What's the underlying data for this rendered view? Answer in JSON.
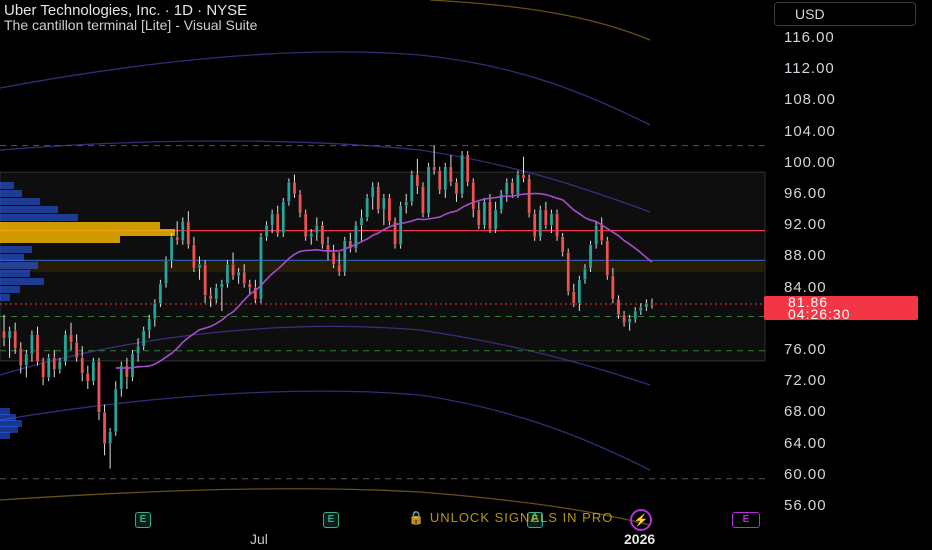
{
  "header": {
    "title": "Uber Technologies, Inc. · 1D · NYSE",
    "subtitle": "The cantillon terminal [Lite] - Visual Suite"
  },
  "currency": "USD",
  "last_price": {
    "value": "81.86",
    "countdown": "04:26:30"
  },
  "y_axis_labels": [
    "116.00",
    "112.00",
    "108.00",
    "104.00",
    "100.00",
    "96.00",
    "92.00",
    "88.00",
    "84.00",
    "76.00",
    "72.00",
    "68.00",
    "64.00",
    "60.00",
    "56.00"
  ],
  "x_axis_labels": [
    "Jul",
    "2026"
  ],
  "overlay": {
    "unlock_text": "UNLOCK SIGNALS IN PRO",
    "earnings_label": "E",
    "bolt_icon": "lightning-icon"
  },
  "colors": {
    "up": "#26a69a",
    "down": "#ef5350",
    "wick": "#e0e0e0",
    "ma": "#a64dc9",
    "band": "#4a3aa0",
    "band_outer": "#8a6a20",
    "red_line": "#f23645",
    "blue_line": "#3060c0",
    "volume_profile": "#2962ff",
    "poc": "#f0b400"
  },
  "chart_data": {
    "type": "candlestick",
    "symbol": "UBER",
    "interval": "1D",
    "exchange": "NYSE",
    "ylim": [
      54,
      118
    ],
    "last_price": 81.86,
    "horizontal_levels": {
      "resistance_dashed": 102.2,
      "range_top": 98.8,
      "red_line": 91.3,
      "blue_line": 87.5,
      "zone_bottom": 86.0,
      "price_dotted": 81.9,
      "green_dashed_1": 80.3,
      "green_dashed_2": 75.9,
      "range_bottom": 74.6,
      "lower_dashed": 59.5
    },
    "candles": [
      {
        "o": 78.5,
        "h": 80.5,
        "l": 76.5,
        "c": 77.5
      },
      {
        "o": 77.5,
        "h": 79.0,
        "l": 75.0,
        "c": 78.5
      },
      {
        "o": 78.5,
        "h": 79.5,
        "l": 75.5,
        "c": 76.2
      },
      {
        "o": 76.2,
        "h": 77.0,
        "l": 73.0,
        "c": 74.0
      },
      {
        "o": 74.0,
        "h": 76.0,
        "l": 72.5,
        "c": 75.5
      },
      {
        "o": 75.5,
        "h": 78.5,
        "l": 74.5,
        "c": 78.0
      },
      {
        "o": 78.0,
        "h": 79.0,
        "l": 74.0,
        "c": 74.5
      },
      {
        "o": 74.5,
        "h": 75.0,
        "l": 71.5,
        "c": 72.5
      },
      {
        "o": 72.5,
        "h": 75.5,
        "l": 72.0,
        "c": 75.0
      },
      {
        "o": 75.0,
        "h": 76.0,
        "l": 72.5,
        "c": 73.5
      },
      {
        "o": 73.5,
        "h": 75.0,
        "l": 73.0,
        "c": 74.5
      },
      {
        "o": 74.5,
        "h": 78.5,
        "l": 74.0,
        "c": 78.0
      },
      {
        "o": 78.0,
        "h": 79.5,
        "l": 76.0,
        "c": 77.0
      },
      {
        "o": 77.0,
        "h": 78.0,
        "l": 74.5,
        "c": 75.0
      },
      {
        "o": 75.0,
        "h": 76.5,
        "l": 72.0,
        "c": 73.0
      },
      {
        "o": 73.0,
        "h": 74.0,
        "l": 71.0,
        "c": 72.0
      },
      {
        "o": 72.0,
        "h": 75.0,
        "l": 71.5,
        "c": 74.5
      },
      {
        "o": 74.5,
        "h": 75.0,
        "l": 67.0,
        "c": 68.0
      },
      {
        "o": 68.0,
        "h": 69.0,
        "l": 62.5,
        "c": 64.0
      },
      {
        "o": 64.0,
        "h": 66.0,
        "l": 60.8,
        "c": 65.5
      },
      {
        "o": 65.5,
        "h": 72.0,
        "l": 65.0,
        "c": 71.0
      },
      {
        "o": 71.0,
        "h": 74.5,
        "l": 70.0,
        "c": 74.0
      },
      {
        "o": 74.0,
        "h": 75.0,
        "l": 71.0,
        "c": 72.5
      },
      {
        "o": 72.5,
        "h": 76.0,
        "l": 72.0,
        "c": 75.5
      },
      {
        "o": 75.5,
        "h": 77.5,
        "l": 74.5,
        "c": 76.5
      },
      {
        "o": 76.5,
        "h": 79.0,
        "l": 76.0,
        "c": 78.5
      },
      {
        "o": 78.5,
        "h": 80.5,
        "l": 77.5,
        "c": 80.0
      },
      {
        "o": 80.0,
        "h": 82.5,
        "l": 79.0,
        "c": 82.0
      },
      {
        "o": 82.0,
        "h": 85.0,
        "l": 81.5,
        "c": 84.5
      },
      {
        "o": 84.5,
        "h": 88.0,
        "l": 84.0,
        "c": 87.5
      },
      {
        "o": 87.5,
        "h": 91.0,
        "l": 86.5,
        "c": 90.5
      },
      {
        "o": 90.5,
        "h": 92.5,
        "l": 89.5,
        "c": 90.0
      },
      {
        "o": 90.0,
        "h": 93.0,
        "l": 89.5,
        "c": 92.5
      },
      {
        "o": 92.5,
        "h": 93.8,
        "l": 89.0,
        "c": 89.5
      },
      {
        "o": 89.5,
        "h": 90.5,
        "l": 86.0,
        "c": 86.5
      },
      {
        "o": 86.5,
        "h": 88.0,
        "l": 85.0,
        "c": 87.0
      },
      {
        "o": 87.0,
        "h": 87.5,
        "l": 82.0,
        "c": 83.0
      },
      {
        "o": 83.0,
        "h": 84.0,
        "l": 81.5,
        "c": 82.5
      },
      {
        "o": 82.5,
        "h": 84.5,
        "l": 82.0,
        "c": 84.0
      },
      {
        "o": 84.0,
        "h": 85.0,
        "l": 81.0,
        "c": 84.5
      },
      {
        "o": 84.5,
        "h": 87.5,
        "l": 84.0,
        "c": 87.0
      },
      {
        "o": 87.0,
        "h": 88.5,
        "l": 85.0,
        "c": 85.5
      },
      {
        "o": 85.5,
        "h": 86.5,
        "l": 84.5,
        "c": 86.0
      },
      {
        "o": 86.0,
        "h": 87.0,
        "l": 84.0,
        "c": 84.5
      },
      {
        "o": 84.5,
        "h": 85.0,
        "l": 83.0,
        "c": 84.0
      },
      {
        "o": 84.0,
        "h": 85.0,
        "l": 82.0,
        "c": 82.5
      },
      {
        "o": 82.5,
        "h": 91.0,
        "l": 82.0,
        "c": 90.5
      },
      {
        "o": 90.5,
        "h": 92.5,
        "l": 90.0,
        "c": 92.0
      },
      {
        "o": 92.0,
        "h": 94.0,
        "l": 91.0,
        "c": 93.5
      },
      {
        "o": 93.5,
        "h": 94.5,
        "l": 90.5,
        "c": 91.0
      },
      {
        "o": 91.0,
        "h": 95.5,
        "l": 90.5,
        "c": 95.0
      },
      {
        "o": 95.0,
        "h": 98.0,
        "l": 94.5,
        "c": 97.5
      },
      {
        "o": 97.5,
        "h": 98.5,
        "l": 95.5,
        "c": 96.0
      },
      {
        "o": 96.0,
        "h": 96.5,
        "l": 93.0,
        "c": 93.5
      },
      {
        "o": 93.5,
        "h": 94.0,
        "l": 90.0,
        "c": 90.5
      },
      {
        "o": 90.5,
        "h": 91.5,
        "l": 89.5,
        "c": 91.0
      },
      {
        "o": 91.0,
        "h": 93.0,
        "l": 90.0,
        "c": 92.0
      },
      {
        "o": 92.0,
        "h": 92.5,
        "l": 89.0,
        "c": 89.5
      },
      {
        "o": 89.5,
        "h": 90.5,
        "l": 87.5,
        "c": 88.5
      },
      {
        "o": 88.5,
        "h": 89.5,
        "l": 86.5,
        "c": 87.0
      },
      {
        "o": 87.0,
        "h": 88.5,
        "l": 85.5,
        "c": 86.0
      },
      {
        "o": 86.0,
        "h": 90.5,
        "l": 85.5,
        "c": 90.0
      },
      {
        "o": 90.0,
        "h": 91.0,
        "l": 88.5,
        "c": 89.0
      },
      {
        "o": 89.0,
        "h": 92.5,
        "l": 88.5,
        "c": 92.0
      },
      {
        "o": 92.0,
        "h": 94.0,
        "l": 90.0,
        "c": 93.0
      },
      {
        "o": 93.0,
        "h": 96.0,
        "l": 92.5,
        "c": 95.5
      },
      {
        "o": 95.5,
        "h": 97.5,
        "l": 94.0,
        "c": 97.0
      },
      {
        "o": 97.0,
        "h": 97.5,
        "l": 93.5,
        "c": 94.0
      },
      {
        "o": 94.0,
        "h": 96.0,
        "l": 92.0,
        "c": 95.5
      },
      {
        "o": 95.5,
        "h": 96.0,
        "l": 92.0,
        "c": 92.5
      },
      {
        "o": 92.5,
        "h": 93.0,
        "l": 89.0,
        "c": 89.5
      },
      {
        "o": 89.5,
        "h": 95.0,
        "l": 89.0,
        "c": 94.5
      },
      {
        "o": 94.5,
        "h": 96.0,
        "l": 93.5,
        "c": 95.0
      },
      {
        "o": 95.0,
        "h": 99.0,
        "l": 94.5,
        "c": 98.5
      },
      {
        "o": 98.5,
        "h": 100.5,
        "l": 96.0,
        "c": 97.0
      },
      {
        "o": 97.0,
        "h": 97.5,
        "l": 93.0,
        "c": 93.5
      },
      {
        "o": 93.5,
        "h": 100.0,
        "l": 93.0,
        "c": 99.5
      },
      {
        "o": 99.5,
        "h": 102.2,
        "l": 98.5,
        "c": 99.0
      },
      {
        "o": 99.0,
        "h": 99.5,
        "l": 96.0,
        "c": 96.5
      },
      {
        "o": 96.5,
        "h": 100.0,
        "l": 95.5,
        "c": 99.5
      },
      {
        "o": 99.5,
        "h": 101.0,
        "l": 97.0,
        "c": 97.5
      },
      {
        "o": 97.5,
        "h": 98.0,
        "l": 95.0,
        "c": 96.0
      },
      {
        "o": 96.0,
        "h": 101.5,
        "l": 95.5,
        "c": 101.0
      },
      {
        "o": 101.0,
        "h": 101.5,
        "l": 97.0,
        "c": 97.5
      },
      {
        "o": 97.5,
        "h": 98.0,
        "l": 93.0,
        "c": 94.0
      },
      {
        "o": 94.0,
        "h": 95.0,
        "l": 91.5,
        "c": 92.0
      },
      {
        "o": 92.0,
        "h": 95.5,
        "l": 91.5,
        "c": 95.0
      },
      {
        "o": 95.0,
        "h": 96.0,
        "l": 91.0,
        "c": 91.5
      },
      {
        "o": 91.5,
        "h": 95.0,
        "l": 91.0,
        "c": 94.0
      },
      {
        "o": 94.0,
        "h": 96.5,
        "l": 93.5,
        "c": 96.0
      },
      {
        "o": 96.0,
        "h": 98.0,
        "l": 95.0,
        "c": 97.5
      },
      {
        "o": 97.5,
        "h": 98.0,
        "l": 95.5,
        "c": 96.0
      },
      {
        "o": 96.0,
        "h": 99.0,
        "l": 95.5,
        "c": 98.5
      },
      {
        "o": 98.5,
        "h": 100.8,
        "l": 97.5,
        "c": 98.0
      },
      {
        "o": 98.0,
        "h": 98.5,
        "l": 93.0,
        "c": 93.5
      },
      {
        "o": 93.5,
        "h": 94.0,
        "l": 90.0,
        "c": 90.5
      },
      {
        "o": 90.5,
        "h": 94.5,
        "l": 90.0,
        "c": 94.0
      },
      {
        "o": 94.0,
        "h": 95.0,
        "l": 91.5,
        "c": 92.0
      },
      {
        "o": 92.0,
        "h": 94.0,
        "l": 91.0,
        "c": 93.5
      },
      {
        "o": 93.5,
        "h": 94.0,
        "l": 90.0,
        "c": 90.5
      },
      {
        "o": 90.5,
        "h": 91.0,
        "l": 88.0,
        "c": 88.5
      },
      {
        "o": 88.5,
        "h": 89.0,
        "l": 83.0,
        "c": 83.5
      },
      {
        "o": 83.5,
        "h": 84.5,
        "l": 81.5,
        "c": 82.0
      },
      {
        "o": 82.0,
        "h": 85.5,
        "l": 81.0,
        "c": 85.0
      },
      {
        "o": 85.0,
        "h": 87.0,
        "l": 84.5,
        "c": 86.5
      },
      {
        "o": 86.5,
        "h": 90.0,
        "l": 86.0,
        "c": 89.5
      },
      {
        "o": 89.5,
        "h": 92.5,
        "l": 89.0,
        "c": 92.0
      },
      {
        "o": 92.0,
        "h": 93.0,
        "l": 89.5,
        "c": 90.0
      },
      {
        "o": 90.0,
        "h": 90.5,
        "l": 85.0,
        "c": 85.5
      },
      {
        "o": 85.5,
        "h": 86.5,
        "l": 82.0,
        "c": 82.5
      },
      {
        "o": 82.5,
        "h": 83.0,
        "l": 80.0,
        "c": 80.5
      },
      {
        "o": 80.5,
        "h": 81.0,
        "l": 79.0,
        "c": 79.5
      },
      {
        "o": 79.5,
        "h": 80.5,
        "l": 78.5,
        "c": 80.0
      },
      {
        "o": 80.0,
        "h": 81.5,
        "l": 79.5,
        "c": 81.0
      },
      {
        "o": 81.0,
        "h": 82.0,
        "l": 80.5,
        "c": 81.5
      },
      {
        "o": 81.5,
        "h": 82.5,
        "l": 81.0,
        "c": 82.0
      },
      {
        "o": 82.0,
        "h": 82.6,
        "l": 81.3,
        "c": 81.86
      }
    ]
  }
}
